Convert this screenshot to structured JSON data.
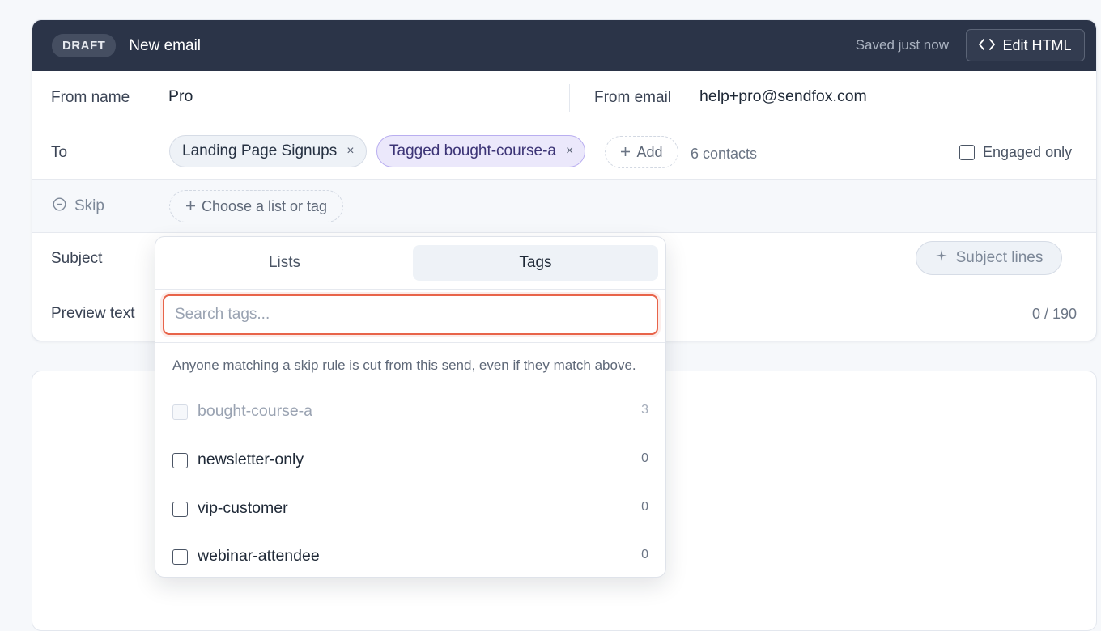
{
  "header": {
    "status_badge": "DRAFT",
    "title": "New email",
    "saved_status": "Saved just now",
    "edit_html_label": "Edit HTML"
  },
  "from": {
    "name_label": "From name",
    "name_value": "Pro",
    "email_label": "From email",
    "email_value": "help+pro@sendfox.com"
  },
  "to": {
    "label": "To",
    "chips": [
      {
        "label": "Landing Page Signups",
        "remove": "×"
      },
      {
        "label": "Tagged bought-course-a",
        "remove": "×"
      }
    ],
    "add_label": "Add",
    "contact_count": "6 contacts",
    "engaged_only_label": "Engaged only"
  },
  "skip": {
    "label": "Skip",
    "choose_label": "Choose a list or tag"
  },
  "subject": {
    "label": "Subject",
    "subject_lines_label": "Subject lines"
  },
  "preview": {
    "label": "Preview text",
    "counter": "0 / 190"
  },
  "dropdown": {
    "tabs": [
      "Lists",
      "Tags"
    ],
    "active_tab": "Tags",
    "search_placeholder": "Search tags...",
    "hint": "Anyone matching a skip rule is cut from this send, even if they match above.",
    "tags": [
      {
        "name": "bought-course-a",
        "count": "3",
        "disabled": true
      },
      {
        "name": "newsletter-only",
        "count": "0",
        "disabled": false
      },
      {
        "name": "vip-customer",
        "count": "0",
        "disabled": false
      },
      {
        "name": "webinar-attendee",
        "count": "0",
        "disabled": false
      }
    ]
  },
  "colors": {
    "header_bg": "#2b3448",
    "accent_focus": "#e8644a",
    "tag_chip_bg": "#ebe8fb",
    "tag_chip_border": "#b9aef0"
  }
}
